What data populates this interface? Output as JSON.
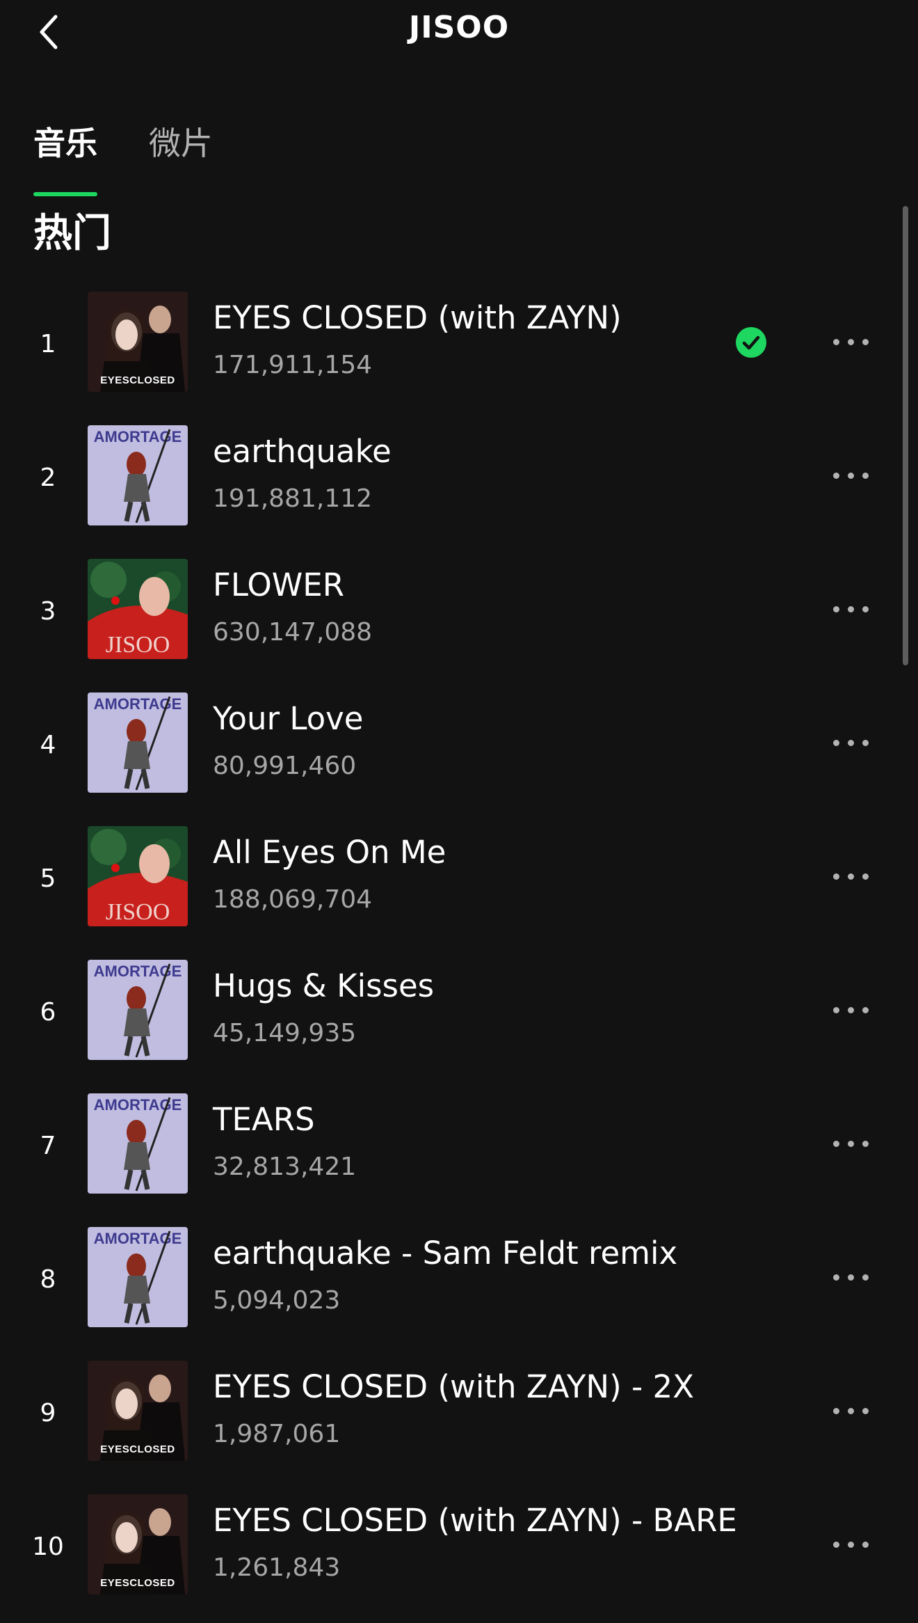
{
  "header": {
    "title": "JISOO",
    "back_icon": "chevron-left-icon"
  },
  "tabs": [
    {
      "label": "音乐",
      "active": true
    },
    {
      "label": "微片",
      "active": false
    }
  ],
  "section_title": "热门",
  "colors": {
    "background": "#121212",
    "accent": "#1ed760",
    "secondary_text": "#a7a7a7"
  },
  "tracks": [
    {
      "index": "1",
      "title": "EYES CLOSED (with ZAYN)",
      "plays": "171,911,154",
      "cover": "eyes-closed",
      "cover_text": "EYESCLOSED",
      "downloaded": true
    },
    {
      "index": "2",
      "title": "earthquake",
      "plays": "191,881,112",
      "cover": "amortage",
      "cover_text": "AMORTAGE",
      "downloaded": false
    },
    {
      "index": "3",
      "title": "FLOWER",
      "plays": "630,147,088",
      "cover": "jisoo",
      "cover_text": "JISOO",
      "downloaded": false
    },
    {
      "index": "4",
      "title": "Your Love",
      "plays": "80,991,460",
      "cover": "amortage",
      "cover_text": "AMORTAGE",
      "downloaded": false
    },
    {
      "index": "5",
      "title": "All Eyes On Me",
      "plays": "188,069,704",
      "cover": "jisoo",
      "cover_text": "JISOO",
      "downloaded": false
    },
    {
      "index": "6",
      "title": "Hugs & Kisses",
      "plays": "45,149,935",
      "cover": "amortage",
      "cover_text": "AMORTAGE",
      "downloaded": false
    },
    {
      "index": "7",
      "title": "TEARS",
      "plays": "32,813,421",
      "cover": "amortage",
      "cover_text": "AMORTAGE",
      "downloaded": false
    },
    {
      "index": "8",
      "title": "earthquake - Sam Feldt remix",
      "plays": "5,094,023",
      "cover": "amortage",
      "cover_text": "AMORTAGE",
      "downloaded": false
    },
    {
      "index": "9",
      "title": "EYES CLOSED (with ZAYN) - 2X",
      "plays": "1,987,061",
      "cover": "eyes-closed",
      "cover_text": "EYESCLOSED",
      "downloaded": false
    },
    {
      "index": "10",
      "title": "EYES CLOSED (with ZAYN) - BARE",
      "plays": "1,261,843",
      "cover": "eyes-closed",
      "cover_text": "EYESCLOSED",
      "downloaded": false
    }
  ]
}
